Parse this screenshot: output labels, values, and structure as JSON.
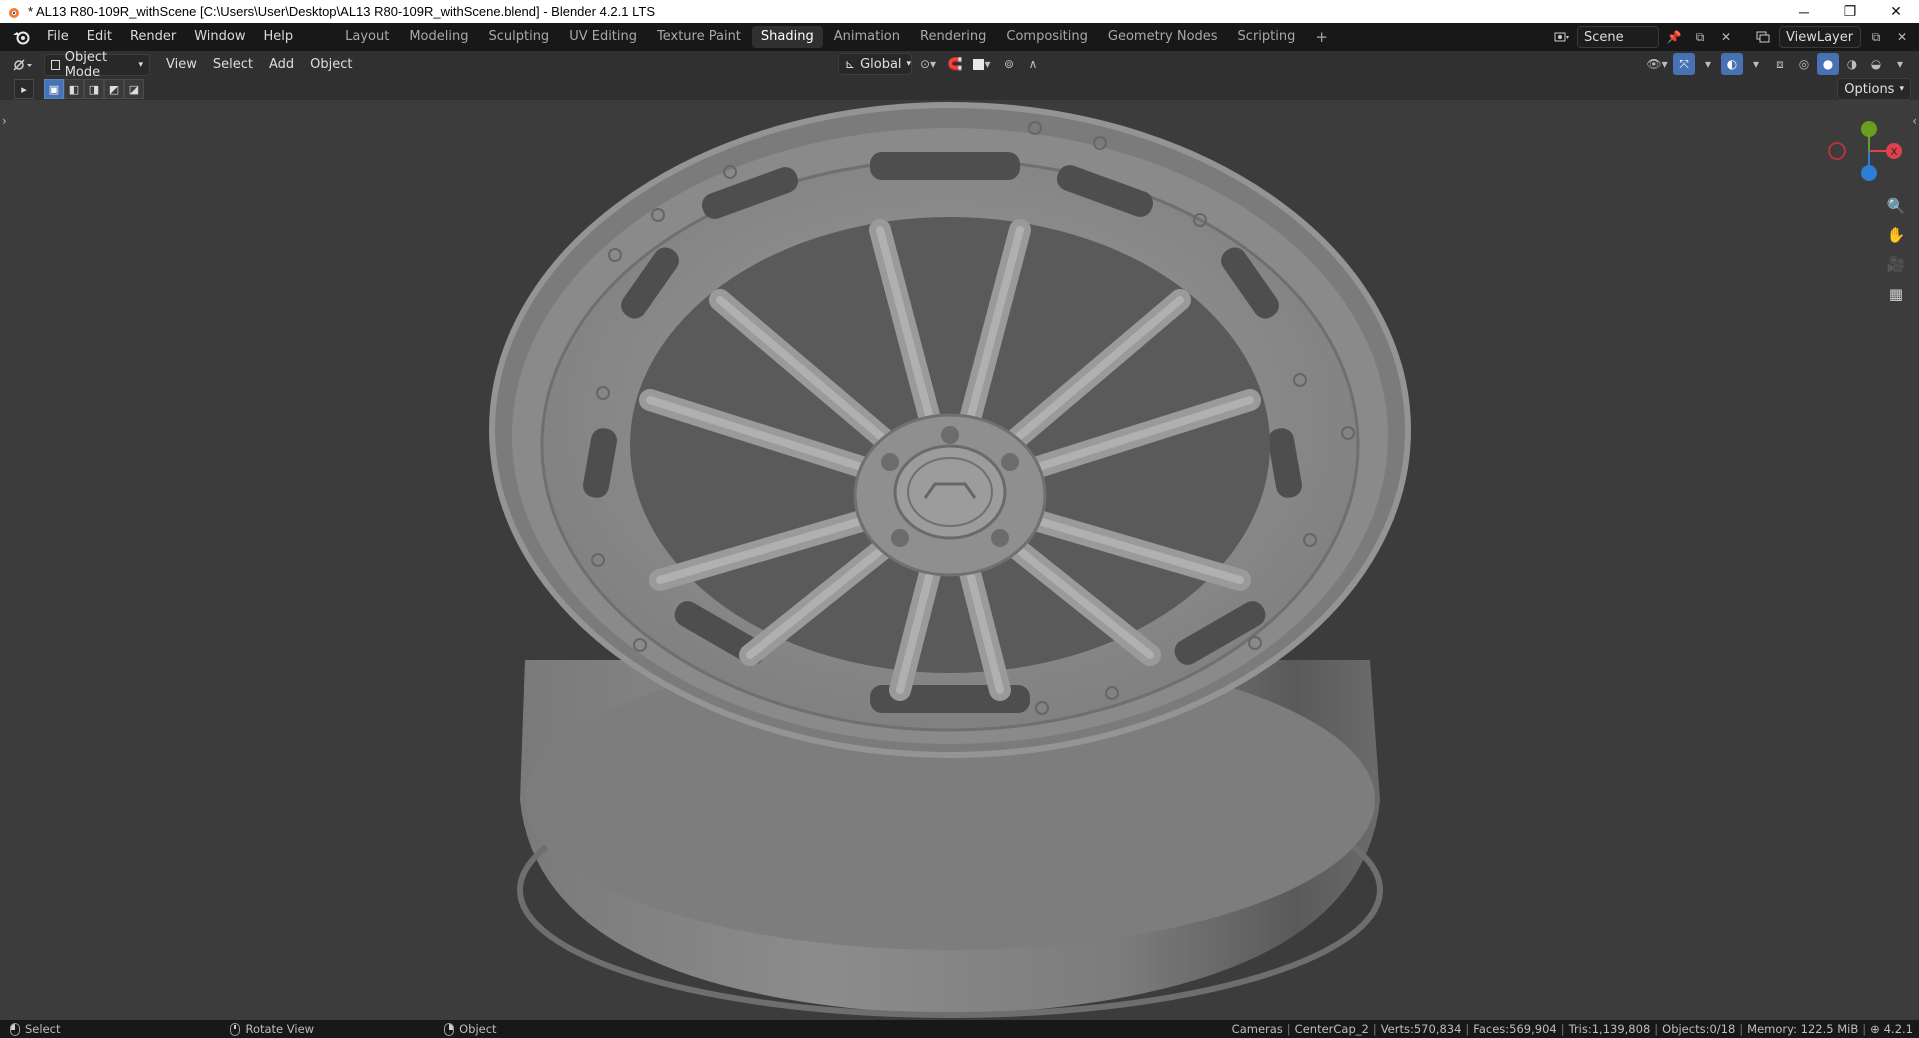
{
  "window": {
    "title": "* AL13 R80-109R_withScene [C:\\Users\\User\\Desktop\\AL13 R80-109R_withScene.blend] - Blender 4.2.1 LTS",
    "controls": [
      "─",
      "❐",
      "✕"
    ]
  },
  "menu": [
    "File",
    "Edit",
    "Render",
    "Window",
    "Help"
  ],
  "workspaces": {
    "active": "Shading",
    "tabs": [
      "Layout",
      "Modeling",
      "Sculpting",
      "UV Editing",
      "Texture Paint",
      "Shading",
      "Animation",
      "Rendering",
      "Compositing",
      "Geometry Nodes",
      "Scripting"
    ],
    "add": "+"
  },
  "scene": {
    "name": "Scene",
    "view_layer": "ViewLayer"
  },
  "header": {
    "mode": "Object Mode",
    "menus": [
      "View",
      "Select",
      "Add",
      "Object"
    ],
    "transform_orientation": "Global",
    "options": "Options"
  },
  "gizmo": {
    "x_label": "X",
    "colors": {
      "x": "#e0414a",
      "y": "#6a9e1f",
      "z": "#2b7fd6"
    }
  },
  "statusbar": {
    "select": "Select",
    "rotate": "Rotate View",
    "object": "Object",
    "stats": [
      "Cameras",
      "CenterCap_2",
      "Verts:570,834",
      "Faces:569,904",
      "Tris:1,139,808",
      "Objects:0/18",
      "Memory: 122.5 MiB"
    ],
    "version": "4.2.1"
  },
  "colors": {
    "accent": "#4772b3",
    "viewport_bg": "#3c3c3c"
  }
}
